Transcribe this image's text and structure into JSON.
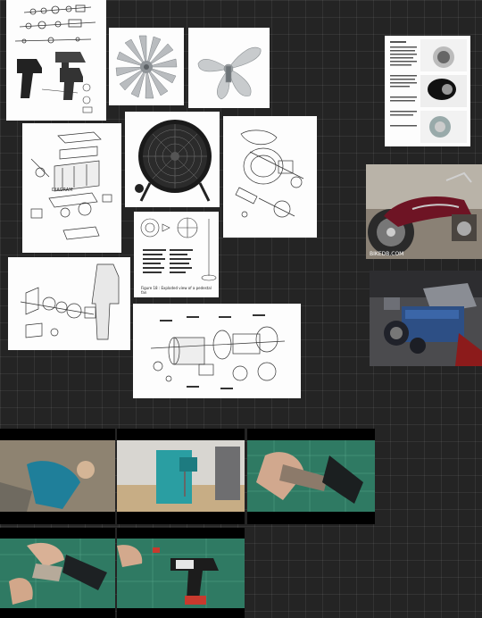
{
  "canvas": {
    "background": "#242424"
  },
  "images": [
    {
      "name": "drill-exploded-diagram"
    },
    {
      "name": "fan-blade-radial"
    },
    {
      "name": "fan-blade-three-wing"
    },
    {
      "name": "engine-block-exploded-diagram"
    },
    {
      "name": "drum-fan-photo"
    },
    {
      "name": "motor-fan-exploded-diagram"
    },
    {
      "name": "pedestal-fan-parts-diagram"
    },
    {
      "name": "drill-gearbox-exploded-diagram"
    },
    {
      "name": "electric-motor-exploded-diagram"
    },
    {
      "name": "motorcycle-manual-page"
    },
    {
      "name": "motorcycle-photo"
    },
    {
      "name": "v8-engine-photo"
    },
    {
      "name": "drill-teardown-video-1"
    },
    {
      "name": "drill-teardown-video-2"
    },
    {
      "name": "drill-teardown-video-3"
    },
    {
      "name": "drill-teardown-video-4"
    },
    {
      "name": "drill-teardown-video-5"
    }
  ],
  "pedestal_caption": "Figure 18 : Exploded view of a pedestal fan",
  "motorcycle_watermark": "BIKEDB.COM"
}
